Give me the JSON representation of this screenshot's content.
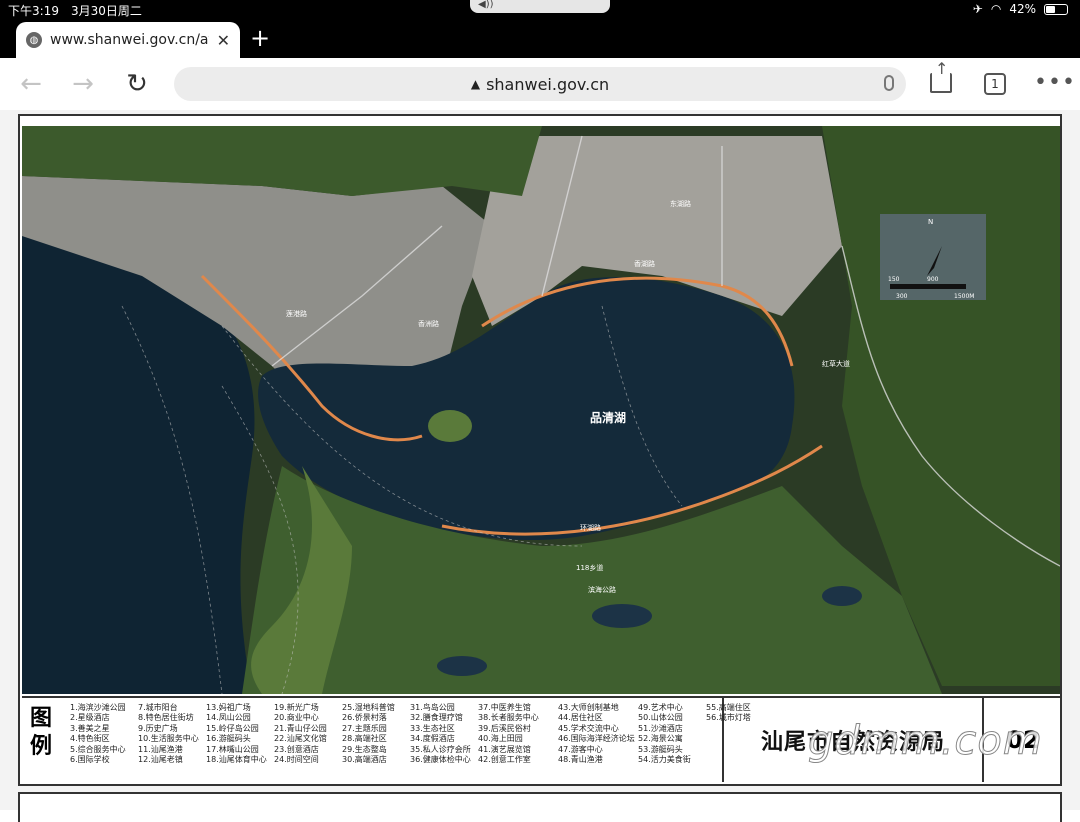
{
  "status": {
    "time": "下午3:19",
    "date": "3月30日周二",
    "battery": "42%"
  },
  "browser": {
    "tab_title": "www.shanwei.gov.cn/att",
    "url": "shanwei.gov.cn",
    "tab_count": "1"
  },
  "map": {
    "lake_label": "品清湖",
    "roads": [
      "香洲路",
      "香湖路",
      "东湖路",
      "红草大道",
      "118乡道",
      "滨海公路",
      "环湖路",
      "莲港路"
    ],
    "scale": {
      "north": "N",
      "values": [
        "150",
        "900",
        "300",
        "1500M"
      ]
    }
  },
  "legend": {
    "title": "图例",
    "columns": [
      [
        "1.海滨沙滩公园",
        "2.星级酒店",
        "3.善美之星",
        "4.特色街区",
        "5.综合服务中心",
        "6.国际学校"
      ],
      [
        "7.城市阳台",
        "8.特色居住街坊",
        "9.历史广场",
        "10.生活服务中心",
        "11.汕尾渔港",
        "12.汕尾老镇"
      ],
      [
        "13.妈祖广场",
        "14.凤山公园",
        "15.岭仔岛公园",
        "16.游艇码头",
        "17.林嘴山公园",
        "18.汕尾体育中心"
      ],
      [
        "19.新光广场",
        "20.商业中心",
        "21.青山仔公园",
        "22.汕尾文化馆",
        "23.创意酒店",
        "24.时间空间"
      ],
      [
        "25.湿地科普馆",
        "26.侨景村落",
        "27.主题乐园",
        "28.高端社区",
        "29.生态整岛",
        "30.高端酒店"
      ],
      [
        "31.鸟岛公园",
        "32.膳食理疗馆",
        "33.生态社区",
        "34.度假酒店",
        "35.私人诊疗会所",
        "36.健康体检中心"
      ],
      [
        "37.中医养生馆",
        "38.长者服务中心",
        "39.后溪民俗村",
        "40.海上田园",
        "41.演艺展览馆",
        "42.创意工作室"
      ],
      [
        "43.大师创制基地",
        "44.居住社区",
        "45.学术交流中心",
        "46.国际海洋经济论坛",
        "47.游客中心",
        "48.青山渔港"
      ],
      [
        "49.艺术中心",
        "50.山体公园",
        "51.沙滩酒店",
        "52.海景公寓",
        "53.游艇码头",
        "54.活力美食街"
      ],
      [
        "55.高端住区",
        "56.城市灯塔"
      ]
    ],
    "org": "汕尾市自然资源局",
    "page": "02"
  },
  "watermark": "gdmm.com"
}
